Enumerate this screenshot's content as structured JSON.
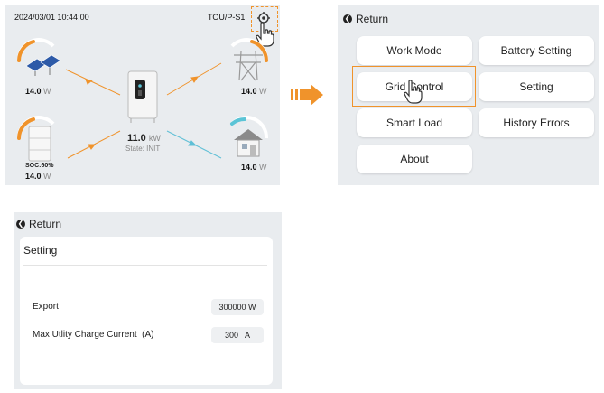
{
  "dashboard": {
    "datetime": "2024/03/01 10:44:00",
    "mode": "TOU/P-S1",
    "pv": {
      "value": "14.0",
      "unit": "W"
    },
    "grid": {
      "value": "14.0",
      "unit": "W"
    },
    "battery": {
      "soc": "SOC:60%",
      "value": "14.0",
      "unit": "W"
    },
    "load": {
      "value": "14.0",
      "unit": "W"
    },
    "inverter": {
      "value": "11.0",
      "unit": "kW",
      "state": "State: INIT"
    }
  },
  "menu": {
    "return_label": "Return",
    "buttons": [
      "Work Mode",
      "Battery Setting",
      "Grid Control",
      "Setting",
      "Smart Load",
      "History Errors",
      "About"
    ]
  },
  "setting_page": {
    "return_label": "Return",
    "title": "Setting",
    "rows": [
      {
        "label": "Export",
        "value": "300000 W"
      },
      {
        "label": "Max Utlity Charge Current  (A)",
        "value": "300   A"
      }
    ]
  },
  "colors": {
    "accent_orange": "#f0932b",
    "panel_bg": "#e9ecef",
    "teal": "#5bc4d6",
    "arrow_blue": "#5fbfd6"
  }
}
